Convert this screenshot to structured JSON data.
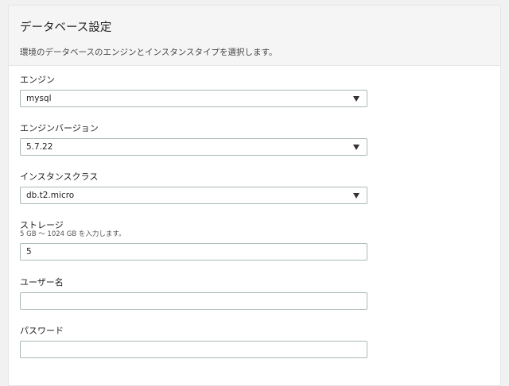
{
  "header": {
    "title": "データベース設定",
    "description": "環境のデータベースのエンジンとインスタンスタイプを選択します。"
  },
  "fields": {
    "engine": {
      "label": "エンジン",
      "value": "mysql"
    },
    "engine_version": {
      "label": "エンジンバージョン",
      "value": "5.7.22"
    },
    "instance_class": {
      "label": "インスタンスクラス",
      "value": "db.t2.micro"
    },
    "storage": {
      "label": "ストレージ",
      "hint": "5 GB ～ 1024 GB を入力します。",
      "value": "5"
    },
    "username": {
      "label": "ユーザー名",
      "value": ""
    },
    "password": {
      "label": "パスワード",
      "value": ""
    }
  },
  "icons": {
    "select_caret": "caret-down-icon"
  }
}
